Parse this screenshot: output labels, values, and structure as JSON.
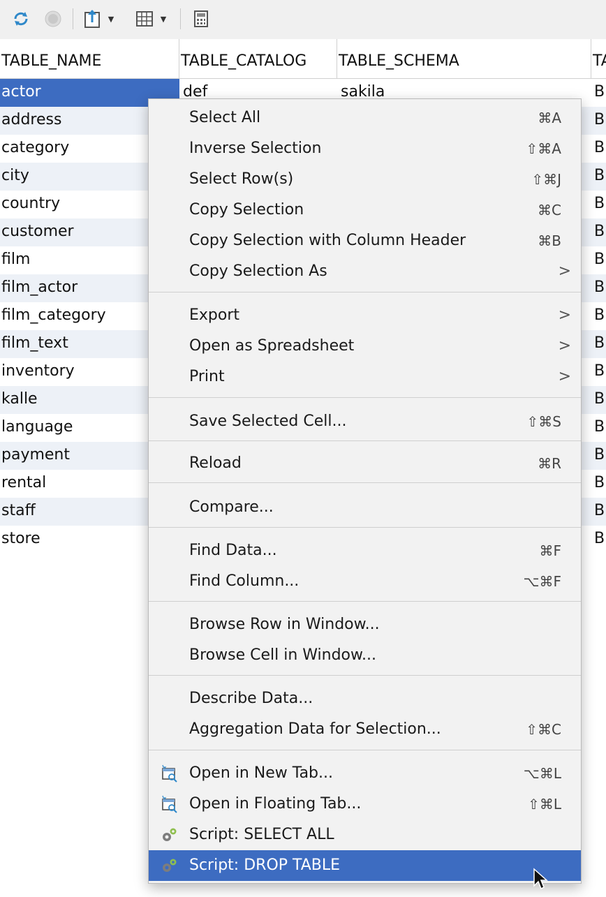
{
  "toolbar": {
    "icons": [
      "refresh-icon",
      "stop-icon",
      "export-icon",
      "grid-layout-icon",
      "calculator-icon"
    ]
  },
  "columns": [
    "TABLE_NAME",
    "TABLE_CATALOG",
    "TABLE_SCHEMA",
    "TA"
  ],
  "rows": [
    {
      "name": "actor",
      "catalog": "def",
      "schema": "sakila",
      "type": "B"
    },
    {
      "name": "address",
      "type": "B"
    },
    {
      "name": "category",
      "type": "B"
    },
    {
      "name": "city",
      "type": "B"
    },
    {
      "name": "country",
      "type": "B"
    },
    {
      "name": "customer",
      "type": "B"
    },
    {
      "name": "film",
      "type": "B"
    },
    {
      "name": "film_actor",
      "type": "B"
    },
    {
      "name": "film_category",
      "type": "B"
    },
    {
      "name": "film_text",
      "type": "B"
    },
    {
      "name": "inventory",
      "type": "B"
    },
    {
      "name": "kalle",
      "type": "B"
    },
    {
      "name": "language",
      "type": "B"
    },
    {
      "name": "payment",
      "type": "B"
    },
    {
      "name": "rental",
      "type": "B"
    },
    {
      "name": "staff",
      "type": "B"
    },
    {
      "name": "store",
      "type": "B"
    }
  ],
  "menu": {
    "items": [
      {
        "label": "Select All",
        "shortcut": "⌘A"
      },
      {
        "label": "Inverse Selection",
        "shortcut": "⇧⌘A"
      },
      {
        "label": "Select Row(s)",
        "shortcut": "⇧⌘J"
      },
      {
        "label": "Copy Selection",
        "shortcut": "⌘C"
      },
      {
        "label": "Copy Selection with Column Header",
        "shortcut": "⌘B"
      },
      {
        "label": "Copy Selection As",
        "submenu": true
      },
      {
        "label": "Export",
        "submenu": true
      },
      {
        "label": "Open as Spreadsheet",
        "submenu": true
      },
      {
        "label": "Print",
        "submenu": true
      },
      {
        "label": "Save Selected Cell...",
        "shortcut": "⇧⌘S"
      },
      {
        "label": "Reload",
        "shortcut": "⌘R"
      },
      {
        "label": "Compare..."
      },
      {
        "label": "Find Data...",
        "shortcut": "⌘F"
      },
      {
        "label": "Find Column...",
        "shortcut": "⌥⌘F"
      },
      {
        "label": "Browse Row in Window..."
      },
      {
        "label": "Browse Cell in Window..."
      },
      {
        "label": "Describe Data..."
      },
      {
        "label": "Aggregation Data for Selection...",
        "shortcut": "⇧⌘C"
      },
      {
        "label": "Open in New Tab...",
        "shortcut": "⌥⌘L",
        "icon": "new-tab-icon"
      },
      {
        "label": "Open in Floating Tab...",
        "shortcut": "⇧⌘L",
        "icon": "floating-tab-icon"
      },
      {
        "label": "Script: SELECT ALL",
        "icon": "script-gear-icon"
      },
      {
        "label": "Script: DROP TABLE",
        "icon": "script-gear-icon",
        "highlighted": true
      }
    ],
    "submenu_glyph": ">"
  },
  "colors": {
    "selection": "#3d6cc1",
    "alt_row": "#edf1f7",
    "menu_bg": "#f2f2f2"
  }
}
